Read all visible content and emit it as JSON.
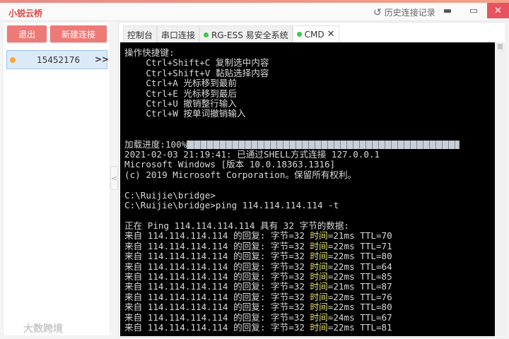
{
  "app": {
    "title": "小锐云桥",
    "history_label": "历史连接记录",
    "accent": "#ee7a78"
  },
  "sidebar": {
    "logout": "退出",
    "new_connection": "新建连接",
    "connections": [
      {
        "id": "15452176",
        "expand": ">>"
      }
    ]
  },
  "tabs": [
    {
      "label": "控制台"
    },
    {
      "label": "串口连接"
    },
    {
      "label": "RG-ESS 易安全系统",
      "status": "online"
    },
    {
      "label": "CMD",
      "status": "online",
      "active": true,
      "close": "✕"
    }
  ],
  "terminal": {
    "shortcuts_title": "操作快捷键:",
    "shortcuts": [
      "    Ctrl+Shift+C 复制选中内容",
      "    Ctrl+Shift+V 黏贴选择内容",
      "    Ctrl+A 光标移到最前",
      "    Ctrl+E 光标移到最后",
      "    Ctrl+U 撤销整行输入",
      "    Ctrl+W 按单词撤销输入"
    ],
    "progress_label": "加载进度:100%",
    "progress": 100,
    "lines": [
      "2021-02-03 21:19:41: 已通过SHELL方式连接 127.0.0.1",
      "Microsoft Windows [版本 10.0.18363.1316]",
      "(c) 2019 Microsoft Corporation。保留所有权利。",
      "",
      "C:\\Ruijie\\bridge>",
      "C:\\Ruijie\\bridge>ping 114.114.114.114 -t",
      "",
      "正在 Ping 114.114.114.114 具有 32 字节的数据:"
    ],
    "replies": [
      {
        "prefix": "来自 114.114.114.114 的回复: 字节=32 ",
        "time": "时间",
        "rest": "=21ms TTL=70"
      },
      {
        "prefix": "来自 114.114.114.114 的回复: 字节=32 ",
        "time": "时间",
        "rest": "=22ms TTL=71"
      },
      {
        "prefix": "来自 114.114.114.114 的回复: 字节=32 ",
        "time": "时间",
        "rest": "=22ms TTL=80"
      },
      {
        "prefix": "来自 114.114.114.114 的回复: 字节=32 ",
        "time": "时间",
        "rest": "=22ms TTL=64"
      },
      {
        "prefix": "来自 114.114.114.114 的回复: 字节=32 ",
        "time": "时间",
        "rest": "=22ms TTL=85"
      },
      {
        "prefix": "来自 114.114.114.114 的回复: 字节=32 ",
        "time": "时间",
        "rest": "=21ms TTL=87"
      },
      {
        "prefix": "来自 114.114.114.114 的回复: 字节=32 ",
        "time": "时间",
        "rest": "=22ms TTL=76"
      },
      {
        "prefix": "来自 114.114.114.114 的回复: 字节=32 ",
        "time": "时间",
        "rest": "=22ms TTL=80"
      },
      {
        "prefix": "来自 114.114.114.114 的回复: 字节=32 ",
        "time": "时间",
        "rest": "=24ms TTL=67"
      },
      {
        "prefix": "来自 114.114.114.114 的回复: 字节=32 ",
        "time": "时间",
        "rest": "=22ms TTL=81"
      }
    ]
  },
  "watermark": "大数跨境"
}
